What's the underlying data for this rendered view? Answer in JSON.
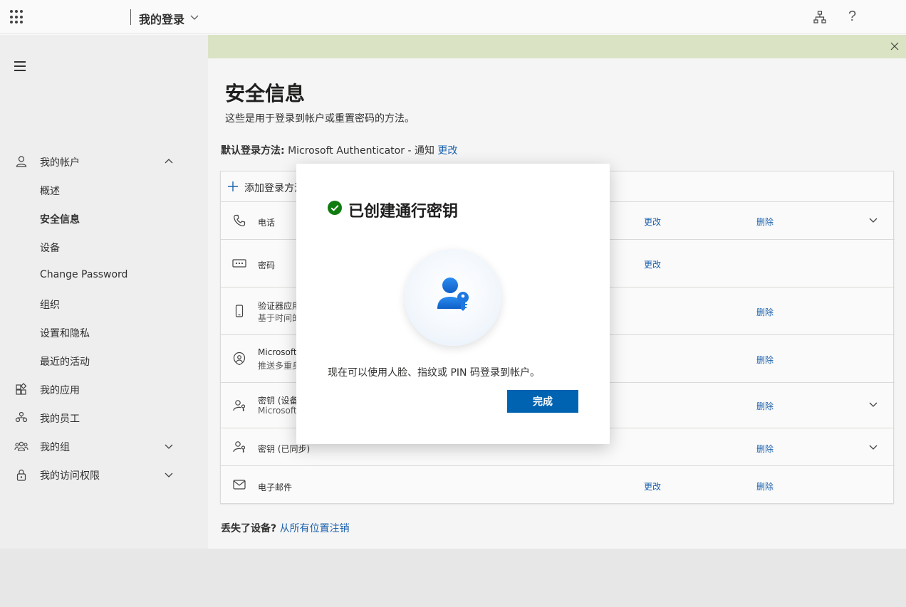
{
  "header": {
    "app_title": "我的登录",
    "help_glyph": "?"
  },
  "nav": {
    "my_account": "我的帐户",
    "sub_items": [
      "概述",
      "安全信息",
      "设备",
      "Change Password",
      "组织",
      "设置和隐私",
      "最近的活动"
    ],
    "my_apps": "我的应用",
    "my_staff": "我的员工",
    "my_groups": "我的组",
    "my_access": "我的访问权限"
  },
  "main": {
    "title": "安全信息",
    "subtitle": "这些是用于登录到帐户或重置密码的方法。",
    "default_label": "默认登录方法:",
    "default_value": "Microsoft Authenticator - 通知",
    "default_change": "更改",
    "add_method": "添加登录方法",
    "methods": [
      {
        "icon": "phone-icon",
        "name": "电话",
        "detail": "",
        "change": "更改",
        "delete": "删除",
        "expand": true
      },
      {
        "icon": "password-icon",
        "name": "密码",
        "detail": "",
        "change": "更改",
        "delete": "",
        "expand": false
      },
      {
        "icon": "mobile-icon",
        "name": "验证器应用",
        "detail": "基于时间的",
        "change": "",
        "delete": "删除",
        "expand": false
      },
      {
        "icon": "authenticator-icon",
        "name": "Microsoft",
        "detail": "推送多重身",
        "change": "",
        "delete": "删除",
        "expand": false
      },
      {
        "icon": "passkey-icon",
        "name": "密钥 (设备",
        "detail": "Microsoft",
        "change": "",
        "delete": "删除",
        "expand": true
      },
      {
        "icon": "passkey-icon",
        "name": "密钥 (已同步)",
        "detail": "",
        "change": "",
        "delete": "删除",
        "expand": true
      },
      {
        "icon": "mail-icon",
        "name": "电子邮件",
        "detail": "",
        "change": "更改",
        "delete": "删除",
        "expand": false
      }
    ],
    "lost_label": "丢失了设备?",
    "lost_link": "从所有位置注销"
  },
  "dialog": {
    "title": "已创建通行密钥",
    "message": "现在可以使用人脸、指纹或 PIN 码登录到帐户。",
    "done_button": "完成"
  },
  "colors": {
    "accent": "#0063b1",
    "link": "#1d64b1",
    "success": "#107c10",
    "banner": "#dfe8c7"
  }
}
